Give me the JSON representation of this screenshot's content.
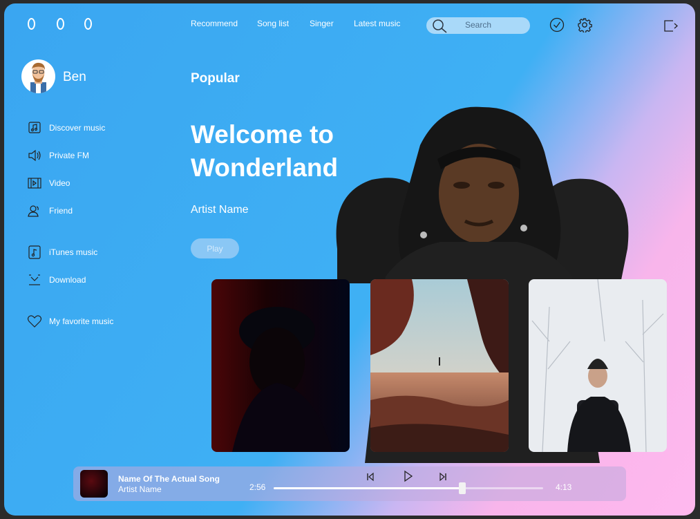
{
  "nav": {
    "items": [
      "Recommend",
      "Song list",
      "Singer",
      "Latest music"
    ]
  },
  "search": {
    "placeholder": "Search"
  },
  "user": {
    "name": "Ben"
  },
  "sidebar": {
    "items": [
      {
        "label": "Discover music",
        "icon": "music-note-box-icon"
      },
      {
        "label": "Private FM",
        "icon": "speaker-icon"
      },
      {
        "label": "Video",
        "icon": "film-icon"
      },
      {
        "label": "Friend",
        "icon": "friend-icon"
      },
      {
        "label": "iTunes music",
        "icon": "music-file-icon"
      },
      {
        "label": "Download",
        "icon": "download-icon"
      },
      {
        "label": "My favorite music",
        "icon": "heart-icon"
      }
    ]
  },
  "hero": {
    "section": "Popular",
    "title": "Welcome to Wonderland",
    "artist": "Artist Name",
    "play_label": "Play"
  },
  "player": {
    "song": "Name Of The Actual Song",
    "artist": "Artist Name",
    "current_time": "2:56",
    "total_time": "4:13",
    "progress": 0.7
  },
  "colors": {
    "bg_start": "#3aa6f1",
    "bg_end": "#ffb8ee",
    "accent": "#ffffff"
  }
}
